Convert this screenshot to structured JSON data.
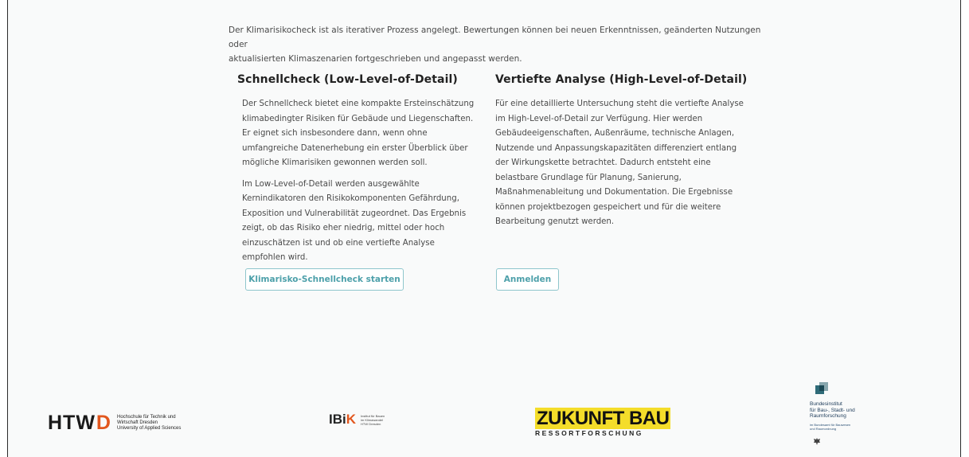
{
  "intro": {
    "line1": "Der Klimarisikocheck ist als iterativer Prozess angelegt. Bewertungen können bei neuen Erkenntnissen, geänderten Nutzungen oder",
    "line2": "aktualisierten Klimaszenarien fortgeschrieben und angepasst werden."
  },
  "left": {
    "title": "Schnellcheck (Low-Level-of-Detail)",
    "p1": "Der Schnellcheck bietet eine kompakte Ersteinschätzung klimabedingter Risiken für Gebäude und Liegenschaften. Er eignet sich insbesondere dann, wenn ohne umfangreiche Datenerhebung ein erster Überblick über mögliche Klimarisiken gewonnen werden soll.",
    "p2": "Im Low-Level-of-Detail werden ausgewählte Kernindikatoren den Risikokomponenten Gefährdung, Exposition und Vulnerabilität zugeordnet. Das Ergebnis zeigt, ob das Risiko eher niedrig, mittel oder hoch einzuschätzen ist und ob eine vertiefte Analyse empfohlen wird.",
    "button": "Klimarisko-Schnellcheck starten"
  },
  "right": {
    "title": "Vertiefte Analyse (High-Level-of-Detail)",
    "p1": "Für eine detaillierte Untersuchung steht die vertiefte Analyse im High-Level-of-Detail zur Verfügung. Hier werden Gebäudeeigenschaften, Außenräume, technische Anlagen, Nutzende und Anpassungskapazitäten differenziert entlang der Wirkungskette betrachtet. Dadurch entsteht eine belastbare Grundlage für Planung, Sanierung, Maßnahmenableitung und Dokumentation. Die Ergebnisse können projektbezogen gespeichert und für die weitere Bearbeitung genutzt werden.",
    "button": "Anmelden"
  },
  "logos": {
    "htw": {
      "word": "HTW",
      "letter": "D",
      "line1": "Hochschule für Technik und",
      "line2": "Wirtschaft Dresden",
      "line3": "University of Applied Sciences"
    },
    "ibik": {
      "word": "IBi",
      "letter": "K",
      "line1": "Institut für Bauen",
      "line2": "im Klimawandel",
      "line3": "HTW Dresden"
    },
    "zukunftbau": {
      "main": "ZUKUNFT BAU",
      "sub": "RESSORTFORSCHUNG"
    },
    "bbsr": {
      "line1": "Bundesinstitut",
      "line2": "für Bau-, Stadt- und",
      "line3": "Raumforschung",
      "sub1": "im Bundesamt für Bauwesen",
      "sub2": "und Raumordnung"
    }
  },
  "colors": {
    "accent": "#4da0aa",
    "htw_orange": "#e2571e",
    "zukunftbau_yellow": "#f4dd2a",
    "bbsr_blue": "#2f6b78"
  }
}
